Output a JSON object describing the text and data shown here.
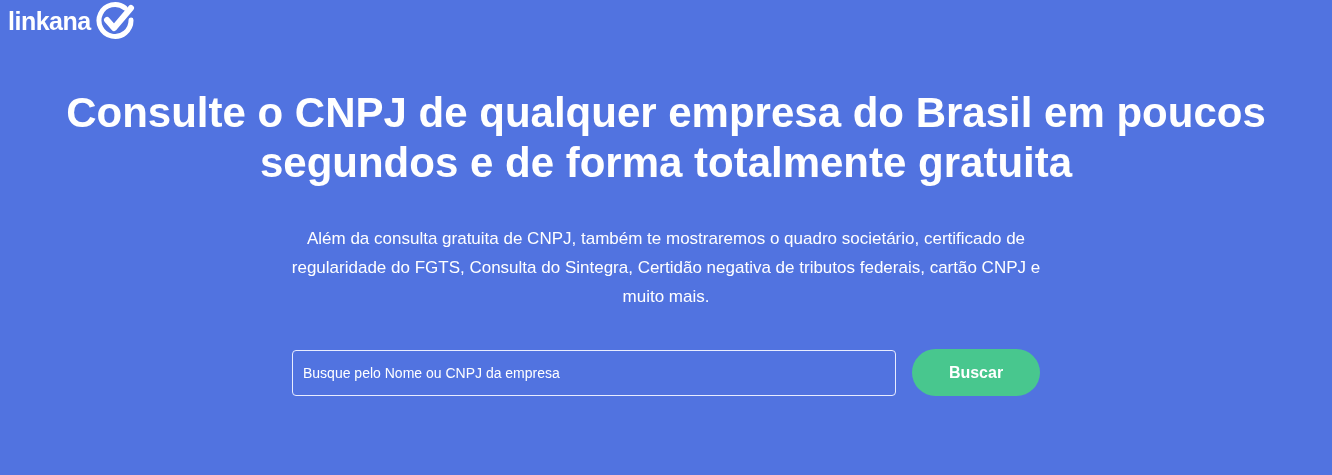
{
  "logo": {
    "text": "linkana"
  },
  "hero": {
    "title": "Consulte o CNPJ de qualquer empresa do Brasil em poucos segundos e de forma totalmente gratuita",
    "subtitle": "Além da consulta gratuita de CNPJ, também te mostraremos o quadro societário, certificado de regularidade do FGTS, Consulta do Sintegra, Certidão negativa de tributos federais, cartão CNPJ e muito mais."
  },
  "search": {
    "placeholder": "Busque pelo Nome ou CNPJ da empresa",
    "button": "Buscar"
  }
}
